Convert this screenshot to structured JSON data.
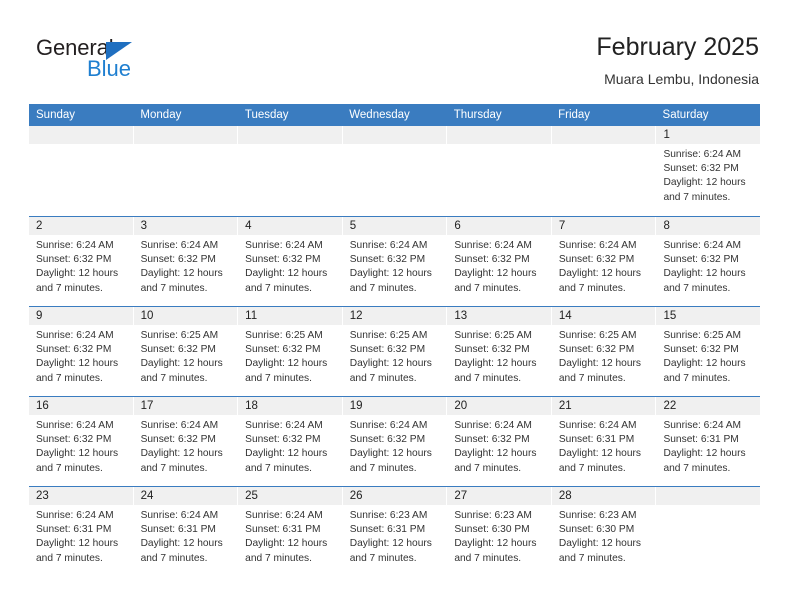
{
  "brand": {
    "name_part1": "General",
    "name_part2": "Blue",
    "accent_color": "#1f7fd0",
    "triangle_color": "#1f6fc0"
  },
  "header": {
    "title": "February 2025",
    "subtitle": "Muara Lembu, Indonesia"
  },
  "calendar": {
    "header_bg": "#3a7cc0",
    "daynum_bg": "#f0f0f0",
    "weekdays": [
      "Sunday",
      "Monday",
      "Tuesday",
      "Wednesday",
      "Thursday",
      "Friday",
      "Saturday"
    ],
    "labels": {
      "sunrise": "Sunrise:",
      "sunset": "Sunset:",
      "daylight": "Daylight:"
    },
    "weeks": [
      [
        {
          "day": "",
          "empty": true
        },
        {
          "day": "",
          "empty": true
        },
        {
          "day": "",
          "empty": true
        },
        {
          "day": "",
          "empty": true
        },
        {
          "day": "",
          "empty": true
        },
        {
          "day": "",
          "empty": true
        },
        {
          "day": "1",
          "sunrise": "Sunrise: 6:24 AM",
          "sunset": "Sunset: 6:32 PM",
          "daylight1": "Daylight: 12 hours",
          "daylight2": "and 7 minutes."
        }
      ],
      [
        {
          "day": "2",
          "sunrise": "Sunrise: 6:24 AM",
          "sunset": "Sunset: 6:32 PM",
          "daylight1": "Daylight: 12 hours",
          "daylight2": "and 7 minutes."
        },
        {
          "day": "3",
          "sunrise": "Sunrise: 6:24 AM",
          "sunset": "Sunset: 6:32 PM",
          "daylight1": "Daylight: 12 hours",
          "daylight2": "and 7 minutes."
        },
        {
          "day": "4",
          "sunrise": "Sunrise: 6:24 AM",
          "sunset": "Sunset: 6:32 PM",
          "daylight1": "Daylight: 12 hours",
          "daylight2": "and 7 minutes."
        },
        {
          "day": "5",
          "sunrise": "Sunrise: 6:24 AM",
          "sunset": "Sunset: 6:32 PM",
          "daylight1": "Daylight: 12 hours",
          "daylight2": "and 7 minutes."
        },
        {
          "day": "6",
          "sunrise": "Sunrise: 6:24 AM",
          "sunset": "Sunset: 6:32 PM",
          "daylight1": "Daylight: 12 hours",
          "daylight2": "and 7 minutes."
        },
        {
          "day": "7",
          "sunrise": "Sunrise: 6:24 AM",
          "sunset": "Sunset: 6:32 PM",
          "daylight1": "Daylight: 12 hours",
          "daylight2": "and 7 minutes."
        },
        {
          "day": "8",
          "sunrise": "Sunrise: 6:24 AM",
          "sunset": "Sunset: 6:32 PM",
          "daylight1": "Daylight: 12 hours",
          "daylight2": "and 7 minutes."
        }
      ],
      [
        {
          "day": "9",
          "sunrise": "Sunrise: 6:24 AM",
          "sunset": "Sunset: 6:32 PM",
          "daylight1": "Daylight: 12 hours",
          "daylight2": "and 7 minutes."
        },
        {
          "day": "10",
          "sunrise": "Sunrise: 6:25 AM",
          "sunset": "Sunset: 6:32 PM",
          "daylight1": "Daylight: 12 hours",
          "daylight2": "and 7 minutes."
        },
        {
          "day": "11",
          "sunrise": "Sunrise: 6:25 AM",
          "sunset": "Sunset: 6:32 PM",
          "daylight1": "Daylight: 12 hours",
          "daylight2": "and 7 minutes."
        },
        {
          "day": "12",
          "sunrise": "Sunrise: 6:25 AM",
          "sunset": "Sunset: 6:32 PM",
          "daylight1": "Daylight: 12 hours",
          "daylight2": "and 7 minutes."
        },
        {
          "day": "13",
          "sunrise": "Sunrise: 6:25 AM",
          "sunset": "Sunset: 6:32 PM",
          "daylight1": "Daylight: 12 hours",
          "daylight2": "and 7 minutes."
        },
        {
          "day": "14",
          "sunrise": "Sunrise: 6:25 AM",
          "sunset": "Sunset: 6:32 PM",
          "daylight1": "Daylight: 12 hours",
          "daylight2": "and 7 minutes."
        },
        {
          "day": "15",
          "sunrise": "Sunrise: 6:25 AM",
          "sunset": "Sunset: 6:32 PM",
          "daylight1": "Daylight: 12 hours",
          "daylight2": "and 7 minutes."
        }
      ],
      [
        {
          "day": "16",
          "sunrise": "Sunrise: 6:24 AM",
          "sunset": "Sunset: 6:32 PM",
          "daylight1": "Daylight: 12 hours",
          "daylight2": "and 7 minutes."
        },
        {
          "day": "17",
          "sunrise": "Sunrise: 6:24 AM",
          "sunset": "Sunset: 6:32 PM",
          "daylight1": "Daylight: 12 hours",
          "daylight2": "and 7 minutes."
        },
        {
          "day": "18",
          "sunrise": "Sunrise: 6:24 AM",
          "sunset": "Sunset: 6:32 PM",
          "daylight1": "Daylight: 12 hours",
          "daylight2": "and 7 minutes."
        },
        {
          "day": "19",
          "sunrise": "Sunrise: 6:24 AM",
          "sunset": "Sunset: 6:32 PM",
          "daylight1": "Daylight: 12 hours",
          "daylight2": "and 7 minutes."
        },
        {
          "day": "20",
          "sunrise": "Sunrise: 6:24 AM",
          "sunset": "Sunset: 6:32 PM",
          "daylight1": "Daylight: 12 hours",
          "daylight2": "and 7 minutes."
        },
        {
          "day": "21",
          "sunrise": "Sunrise: 6:24 AM",
          "sunset": "Sunset: 6:31 PM",
          "daylight1": "Daylight: 12 hours",
          "daylight2": "and 7 minutes."
        },
        {
          "day": "22",
          "sunrise": "Sunrise: 6:24 AM",
          "sunset": "Sunset: 6:31 PM",
          "daylight1": "Daylight: 12 hours",
          "daylight2": "and 7 minutes."
        }
      ],
      [
        {
          "day": "23",
          "sunrise": "Sunrise: 6:24 AM",
          "sunset": "Sunset: 6:31 PM",
          "daylight1": "Daylight: 12 hours",
          "daylight2": "and 7 minutes."
        },
        {
          "day": "24",
          "sunrise": "Sunrise: 6:24 AM",
          "sunset": "Sunset: 6:31 PM",
          "daylight1": "Daylight: 12 hours",
          "daylight2": "and 7 minutes."
        },
        {
          "day": "25",
          "sunrise": "Sunrise: 6:24 AM",
          "sunset": "Sunset: 6:31 PM",
          "daylight1": "Daylight: 12 hours",
          "daylight2": "and 7 minutes."
        },
        {
          "day": "26",
          "sunrise": "Sunrise: 6:23 AM",
          "sunset": "Sunset: 6:31 PM",
          "daylight1": "Daylight: 12 hours",
          "daylight2": "and 7 minutes."
        },
        {
          "day": "27",
          "sunrise": "Sunrise: 6:23 AM",
          "sunset": "Sunset: 6:30 PM",
          "daylight1": "Daylight: 12 hours",
          "daylight2": "and 7 minutes."
        },
        {
          "day": "28",
          "sunrise": "Sunrise: 6:23 AM",
          "sunset": "Sunset: 6:30 PM",
          "daylight1": "Daylight: 12 hours",
          "daylight2": "and 7 minutes."
        },
        {
          "day": "",
          "empty": true
        }
      ]
    ]
  }
}
